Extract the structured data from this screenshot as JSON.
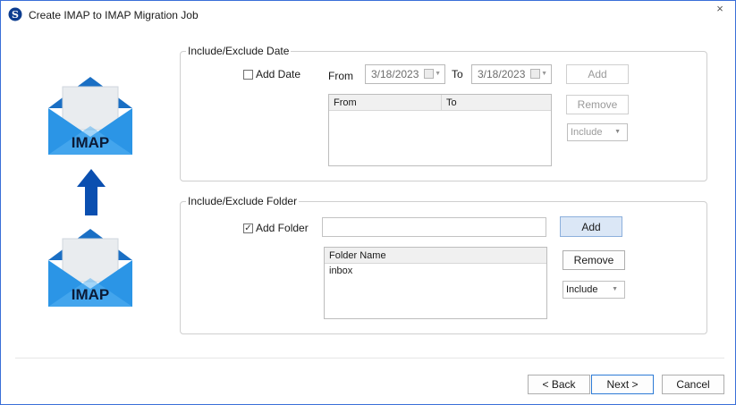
{
  "window": {
    "title": "Create IMAP to IMAP Migration Job",
    "close_glyph": "×"
  },
  "illustration": {
    "target_label": "IMAP",
    "source_label": "IMAP",
    "envelope_color": "#1e88d8",
    "arrow_color": "#0a4fb0"
  },
  "date_group": {
    "legend": "Include/Exclude Date",
    "add_date_label": "Add Date",
    "add_date_checked": false,
    "from_label": "From",
    "from_value": "3/18/2023",
    "to_label": "To",
    "to_value": "3/18/2023",
    "add_button": "Add",
    "remove_button": "Remove",
    "columns": [
      "From",
      "To"
    ],
    "rows": [],
    "filter_value": "Include"
  },
  "folder_group": {
    "legend": "Include/Exclude Folder",
    "add_folder_label": "Add Folder",
    "add_folder_checked": true,
    "folder_input_value": "",
    "add_button": "Add",
    "remove_button": "Remove",
    "column": "Folder Name",
    "rows": [
      "inbox"
    ],
    "filter_value": "Include"
  },
  "footer": {
    "back": "< Back",
    "next": "Next >",
    "cancel": "Cancel"
  }
}
